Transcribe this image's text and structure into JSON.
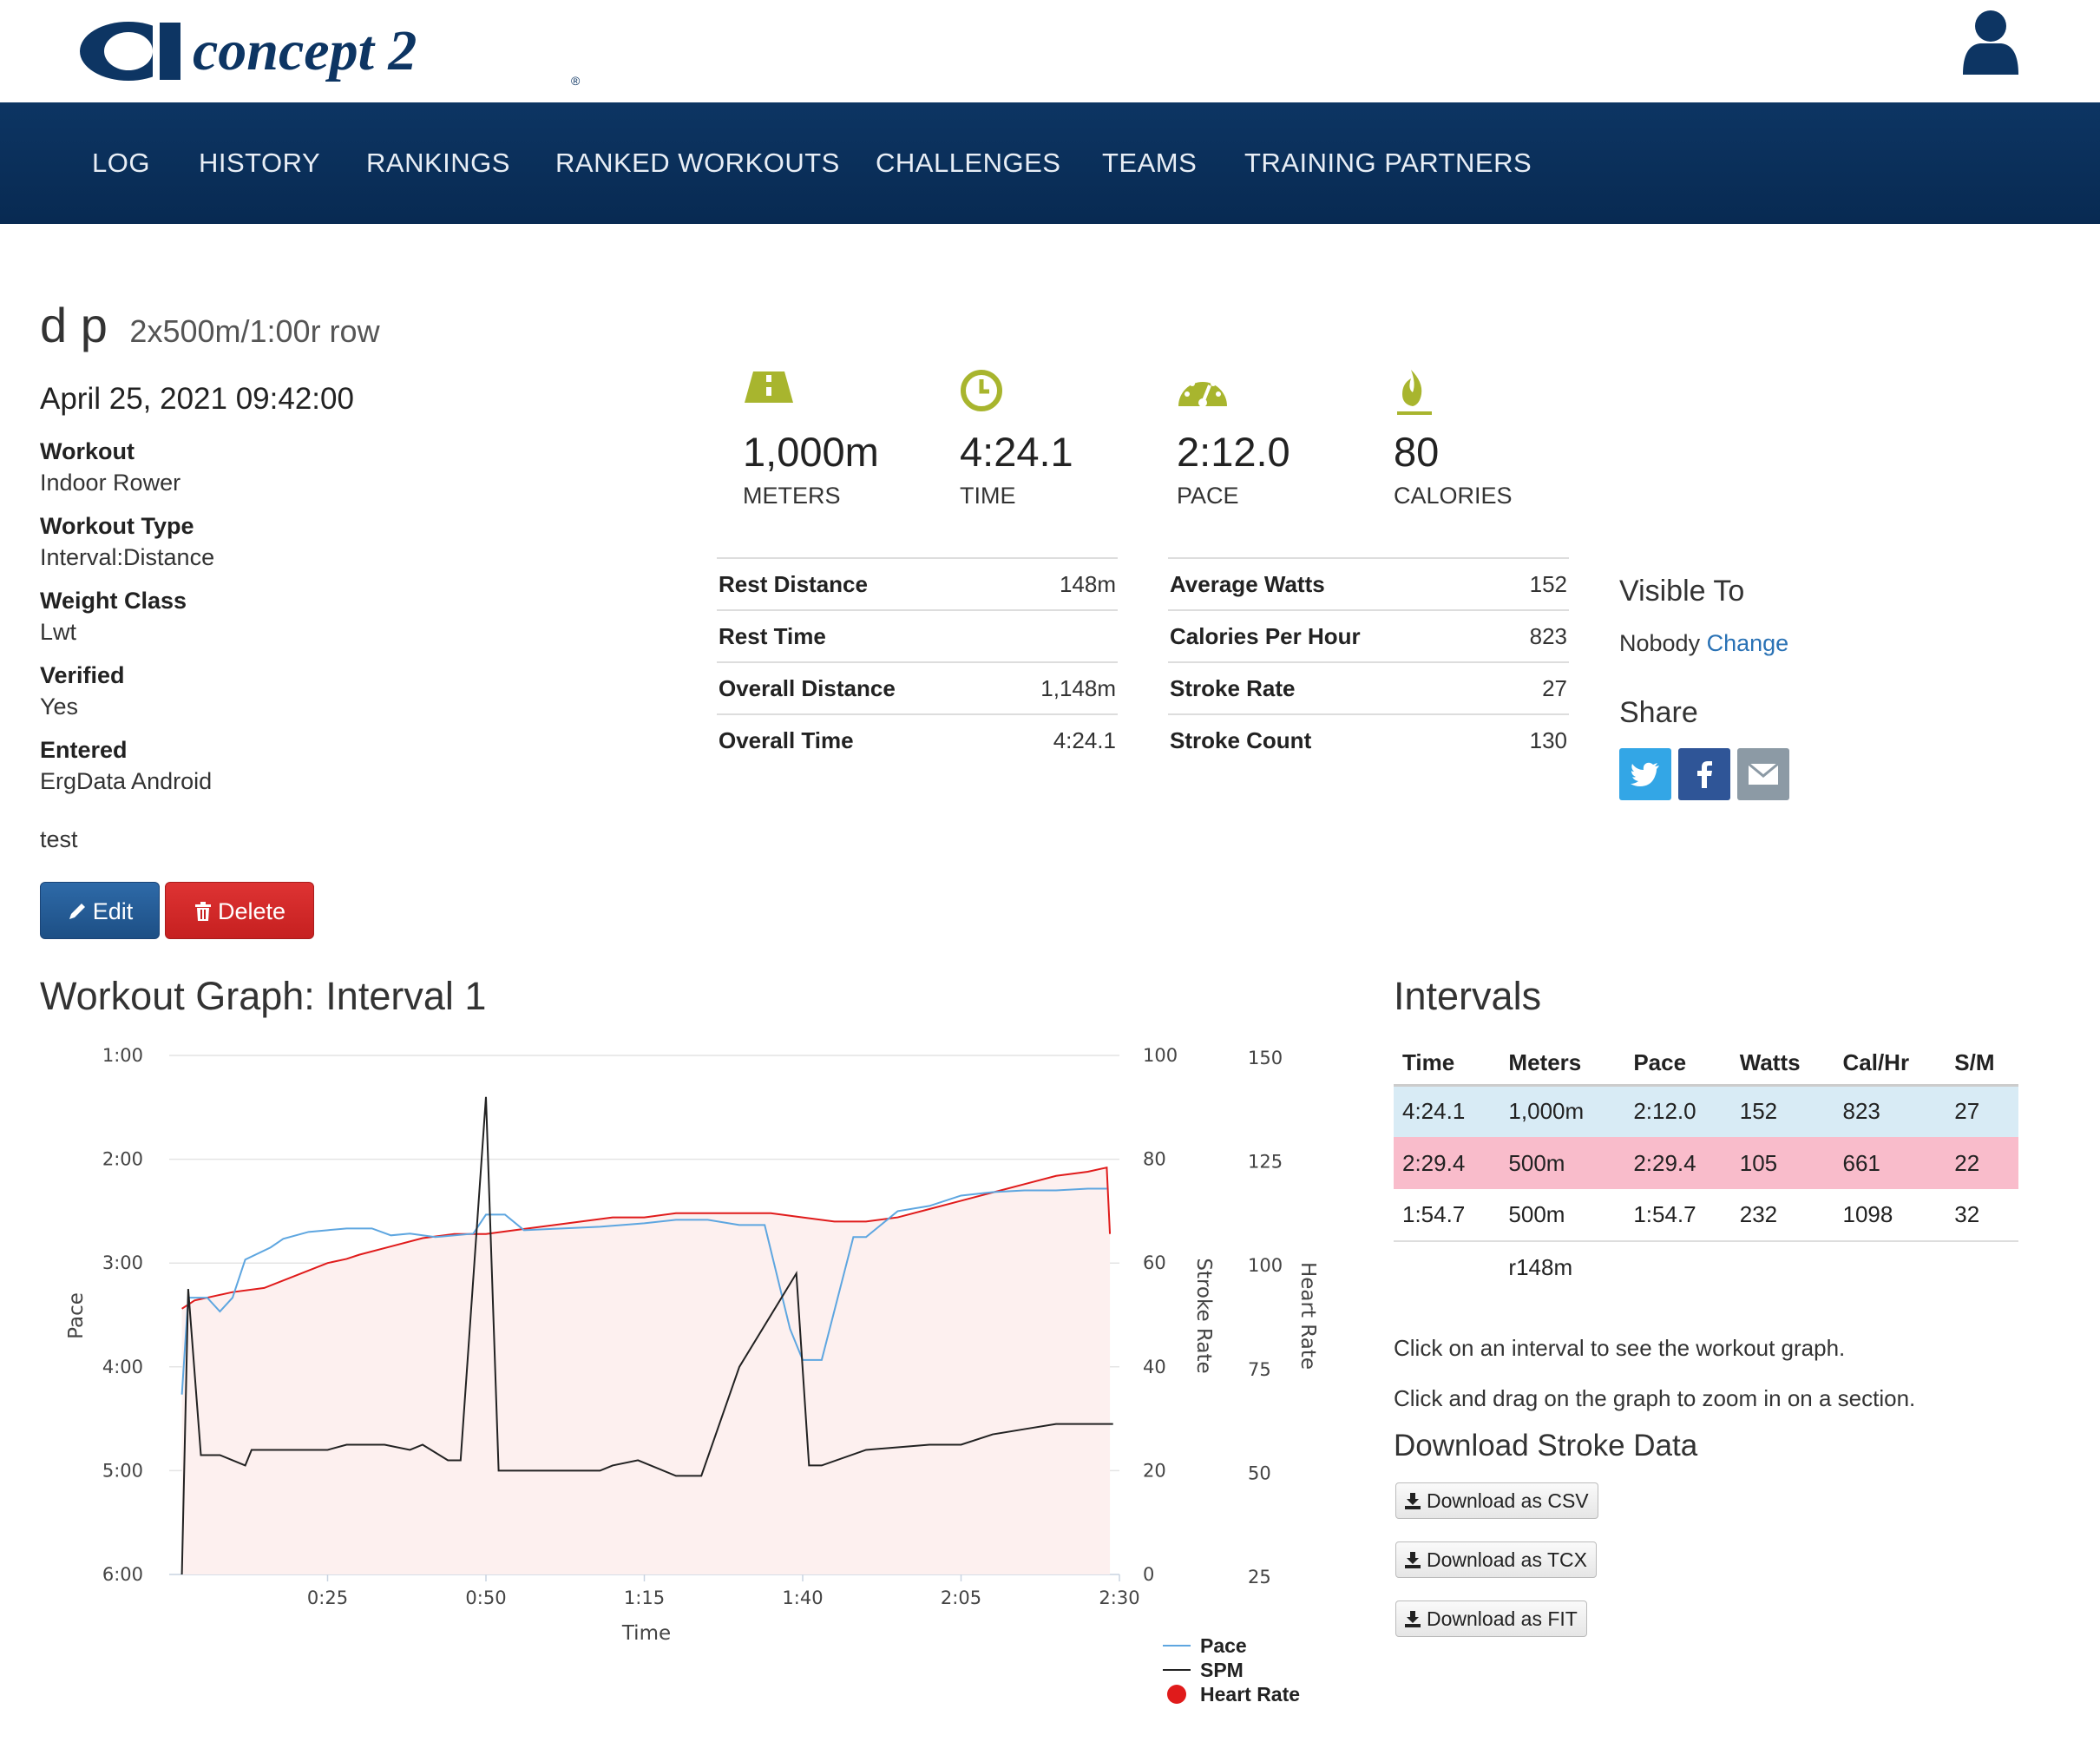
{
  "brand": {
    "name": "concept 2",
    "registered": "®"
  },
  "nav": [
    "LOG",
    "HISTORY",
    "RANKINGS",
    "RANKED WORKOUTS",
    "CHALLENGES",
    "TEAMS",
    "TRAINING PARTNERS"
  ],
  "workout": {
    "user": "d p",
    "summary": "2x500m/1:00r row",
    "date": "April 25, 2021 09:42:00",
    "details": [
      {
        "label": "Workout",
        "value": "Indoor Rower"
      },
      {
        "label": "Workout Type",
        "value": "Interval:Distance"
      },
      {
        "label": "Weight Class",
        "value": "Lwt"
      },
      {
        "label": "Verified",
        "value": "Yes"
      },
      {
        "label": "Entered",
        "value": "ErgData Android"
      }
    ],
    "comment": "test",
    "edit_label": "Edit",
    "delete_label": "Delete"
  },
  "stats": [
    {
      "icon": "road-icon",
      "value": "1,000m",
      "label": "METERS"
    },
    {
      "icon": "clock-icon",
      "value": "4:24.1",
      "label": "TIME"
    },
    {
      "icon": "speedometer-icon",
      "value": "2:12.0",
      "label": "PACE"
    },
    {
      "icon": "flame-icon",
      "value": "80",
      "label": "CALORIES"
    }
  ],
  "stat_color": "#a8b52e",
  "rest_table": [
    {
      "key": "Rest Distance",
      "value": "148m"
    },
    {
      "key": "Rest Time",
      "value": ""
    },
    {
      "key": "Overall Distance",
      "value": "1,148m"
    },
    {
      "key": "Overall Time",
      "value": "4:24.1"
    }
  ],
  "power_table": [
    {
      "key": "Average Watts",
      "value": "152"
    },
    {
      "key": "Calories Per Hour",
      "value": "823"
    },
    {
      "key": "Stroke Rate",
      "value": "27"
    },
    {
      "key": "Stroke Count",
      "value": "130"
    }
  ],
  "visibility": {
    "title": "Visible To",
    "value": "Nobody",
    "change_label": "Change"
  },
  "share": {
    "title": "Share"
  },
  "graph": {
    "title": "Workout Graph: Interval 1",
    "pace_ticks": [
      "1:00",
      "2:00",
      "3:00",
      "4:00",
      "5:00",
      "6:00"
    ],
    "spm_ticks": [
      "100",
      "80",
      "60",
      "40",
      "20",
      "0"
    ],
    "hr_ticks": [
      "150",
      "125",
      "100",
      "75",
      "50",
      "25"
    ],
    "time_ticks": [
      "0:25",
      "0:50",
      "1:15",
      "1:40",
      "2:05",
      "2:30"
    ],
    "xlabel": "Time",
    "ylabel_left": "Pace",
    "ylabel_spm": "Stroke Rate",
    "ylabel_hr": "Heart Rate",
    "legend": [
      "Pace",
      "SPM",
      "Heart Rate"
    ],
    "colors": {
      "pace": "#5ea6e0",
      "spm": "#222222",
      "hr": "#e01b1b",
      "hr_fill": "#fdf0ef"
    }
  },
  "chart_data": {
    "type": "line",
    "xlabel": "Time",
    "x_unit": "seconds",
    "xlim": [
      0,
      150
    ],
    "series": [
      {
        "name": "Pace",
        "axis": "Pace (min:sec per 500m, inverted)",
        "ylim_seconds": [
          60,
          360
        ],
        "points": [
          [
            2,
            256
          ],
          [
            3,
            200
          ],
          [
            6,
            200
          ],
          [
            8,
            208
          ],
          [
            10,
            200
          ],
          [
            12,
            178
          ],
          [
            16,
            171
          ],
          [
            18,
            166
          ],
          [
            22,
            162
          ],
          [
            25,
            161
          ],
          [
            28,
            160
          ],
          [
            32,
            160
          ],
          [
            35,
            164
          ],
          [
            38,
            163
          ],
          [
            42,
            165
          ],
          [
            48,
            163
          ],
          [
            50,
            152
          ],
          [
            53,
            152
          ],
          [
            56,
            161
          ],
          [
            62,
            160
          ],
          [
            68,
            159
          ],
          [
            75,
            157
          ],
          [
            80,
            155
          ],
          [
            85,
            155
          ],
          [
            90,
            158
          ],
          [
            94,
            158
          ],
          [
            98,
            218
          ],
          [
            100,
            236
          ],
          [
            103,
            236
          ],
          [
            108,
            165
          ],
          [
            110,
            165
          ],
          [
            115,
            150
          ],
          [
            120,
            147
          ],
          [
            125,
            141
          ],
          [
            130,
            139
          ],
          [
            135,
            138
          ],
          [
            140,
            138
          ],
          [
            145,
            137
          ],
          [
            148,
            137
          ]
        ]
      },
      {
        "name": "SPM",
        "axis": "Stroke Rate",
        "ylim": [
          0,
          100
        ],
        "points": [
          [
            2,
            0
          ],
          [
            3,
            55
          ],
          [
            5,
            23
          ],
          [
            8,
            23
          ],
          [
            12,
            21
          ],
          [
            13,
            24
          ],
          [
            16,
            24
          ],
          [
            25,
            24
          ],
          [
            28,
            25
          ],
          [
            33,
            25
          ],
          [
            34,
            25
          ],
          [
            38,
            24
          ],
          [
            40,
            25
          ],
          [
            44,
            22
          ],
          [
            46,
            22
          ],
          [
            50,
            92
          ],
          [
            52,
            20
          ],
          [
            60,
            20
          ],
          [
            68,
            20
          ],
          [
            70,
            21
          ],
          [
            74,
            22
          ],
          [
            80,
            19
          ],
          [
            84,
            19
          ],
          [
            90,
            40
          ],
          [
            99,
            58
          ],
          [
            101,
            21
          ],
          [
            103,
            21
          ],
          [
            110,
            24
          ],
          [
            120,
            25
          ],
          [
            125,
            25
          ],
          [
            130,
            27
          ],
          [
            135,
            28
          ],
          [
            140,
            29
          ],
          [
            145,
            29
          ],
          [
            149,
            29
          ]
        ]
      },
      {
        "name": "Heart Rate",
        "axis": "Heart Rate",
        "ylim": [
          25,
          150
        ],
        "points": [
          [
            2,
            89
          ],
          [
            4,
            91
          ],
          [
            10,
            93
          ],
          [
            15,
            94
          ],
          [
            20,
            97
          ],
          [
            25,
            100
          ],
          [
            28,
            101
          ],
          [
            30,
            102
          ],
          [
            35,
            104
          ],
          [
            40,
            106
          ],
          [
            45,
            107
          ],
          [
            50,
            107
          ],
          [
            55,
            108
          ],
          [
            60,
            109
          ],
          [
            65,
            110
          ],
          [
            70,
            111
          ],
          [
            72,
            111
          ],
          [
            75,
            111
          ],
          [
            80,
            112
          ],
          [
            85,
            112
          ],
          [
            90,
            112
          ],
          [
            95,
            112
          ],
          [
            100,
            111
          ],
          [
            105,
            110
          ],
          [
            110,
            110
          ],
          [
            115,
            111
          ],
          [
            120,
            113
          ],
          [
            125,
            115
          ],
          [
            130,
            117
          ],
          [
            135,
            119
          ],
          [
            140,
            121
          ],
          [
            145,
            122
          ],
          [
            148,
            123
          ],
          [
            148.5,
            107
          ]
        ]
      }
    ]
  },
  "intervals": {
    "title": "Intervals",
    "headers": [
      "Time",
      "Meters",
      "Pace",
      "Watts",
      "Cal/Hr",
      "S/M"
    ],
    "rows": [
      [
        "4:24.1",
        "1,000m",
        "2:12.0",
        "152",
        "823",
        "27"
      ],
      [
        "2:29.4",
        "500m",
        "2:29.4",
        "105",
        "661",
        "22"
      ],
      [
        "1:54.7",
        "500m",
        "1:54.7",
        "232",
        "1098",
        "32"
      ]
    ],
    "rest_row": "r148m",
    "hint1": "Click on an interval to see the workout graph.",
    "hint2": "Click and drag on the graph to zoom in on a section.",
    "download_title": "Download Stroke Data",
    "downloads": [
      "Download as CSV",
      "Download as TCX",
      "Download as FIT"
    ]
  }
}
